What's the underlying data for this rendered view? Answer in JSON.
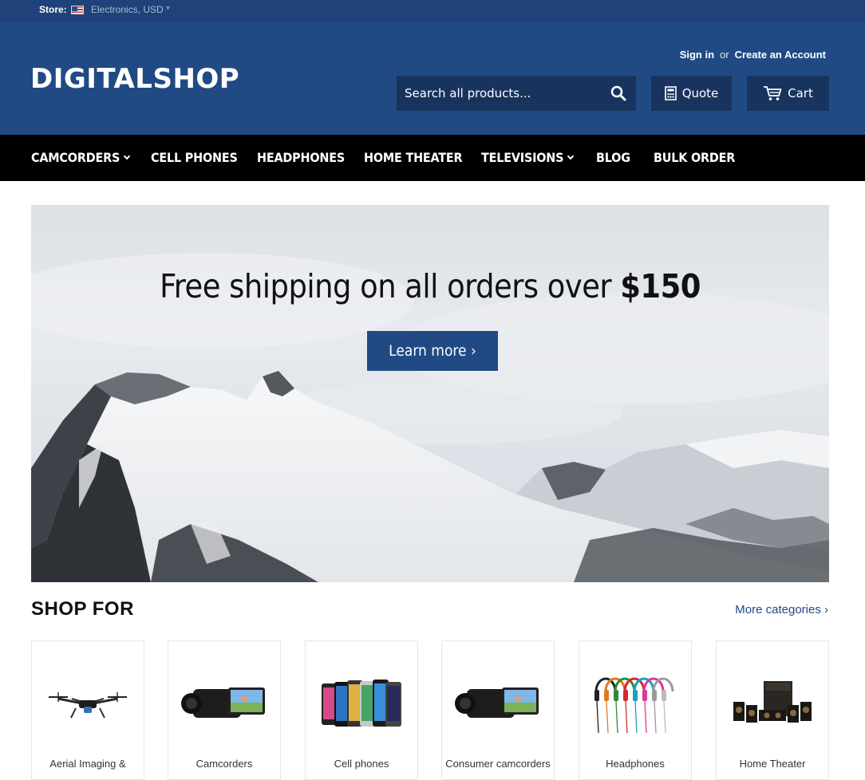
{
  "topbar": {
    "store_label": "Store:",
    "store_value": "Electronics, USD"
  },
  "header": {
    "logo": "DIGITALSHOP",
    "sign_in": "Sign in",
    "or": "or",
    "create_account": "Create an Account",
    "search_placeholder": "Search all products...",
    "quote_label": "Quote",
    "cart_label": "Cart"
  },
  "nav": {
    "items": [
      {
        "label": "CAMCORDERS",
        "dropdown": true
      },
      {
        "label": "CELL PHONES",
        "dropdown": false
      },
      {
        "label": "HEADPHONES",
        "dropdown": false
      },
      {
        "label": "HOME THEATER",
        "dropdown": false
      },
      {
        "label": "TELEVISIONS",
        "dropdown": true
      },
      {
        "label": "BLOG",
        "dropdown": false
      },
      {
        "label": "BULK ORDER",
        "dropdown": false
      }
    ]
  },
  "hero": {
    "title_text": "Free shipping on all orders over ",
    "title_price": "$150",
    "button_label": "Learn more ›"
  },
  "shop": {
    "title": "SHOP FOR",
    "more_label": "More categories ›",
    "categories": [
      {
        "label": "Aerial Imaging &",
        "icon": "drone-icon"
      },
      {
        "label": "Camcorders",
        "icon": "camcorder-icon"
      },
      {
        "label": "Cell phones",
        "icon": "cell-phones-icon"
      },
      {
        "label": "Consumer camcorders",
        "icon": "camcorder-icon"
      },
      {
        "label": "Headphones",
        "icon": "headphones-icon"
      },
      {
        "label": "Home Theater",
        "icon": "home-theater-icon"
      }
    ]
  },
  "colors": {
    "topbar": "#1e4279",
    "header": "#214a85",
    "header_dark": "#18345e",
    "nav": "#000000",
    "link": "#214a85"
  }
}
